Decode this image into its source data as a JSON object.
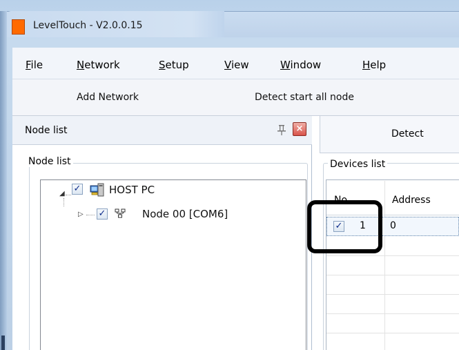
{
  "window": {
    "title": "LevelTouch - V2.0.0.15",
    "accent_color": "#ff6a00"
  },
  "menu": {
    "file": {
      "mnemonic": "F",
      "rest": "ile"
    },
    "network": {
      "mnemonic": "N",
      "rest": "etwork"
    },
    "setup": {
      "mnemonic": "S",
      "rest": "etup"
    },
    "view": {
      "mnemonic": "V",
      "rest": "iew"
    },
    "window": {
      "mnemonic": "W",
      "rest": "indow"
    },
    "help": {
      "mnemonic": "H",
      "rest": "elp"
    }
  },
  "toolbar": {
    "add_network": "Add Network",
    "detect_start_all_node": "Detect start all node"
  },
  "node_panel": {
    "title": "Node list",
    "pin_icon": "pin-icon",
    "close_icon": "close-icon",
    "group_label": "Node list",
    "tree": [
      {
        "label": "HOST PC",
        "checked": true,
        "icon": "host-pc-icon",
        "expanded": true
      },
      {
        "label": "Node 00 [COM6]",
        "checked": true,
        "icon": "network-node-icon",
        "expanded": false
      }
    ]
  },
  "detect_tab": {
    "label": "Detect"
  },
  "devices": {
    "group_label": "Devices list",
    "columns": [
      "No",
      "Address"
    ],
    "rows": [
      {
        "checked": true,
        "no": "1",
        "address": "0"
      }
    ]
  }
}
